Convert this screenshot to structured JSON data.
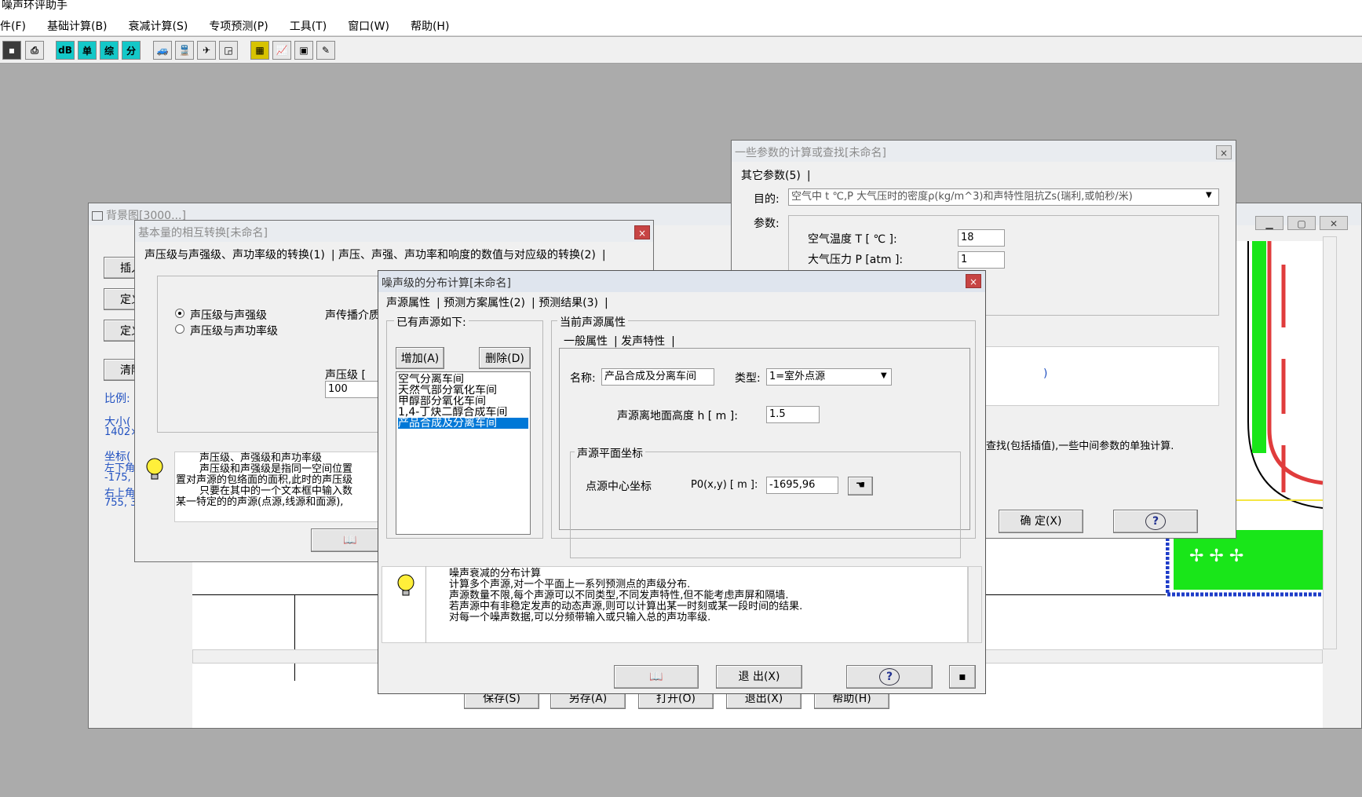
{
  "app": {
    "title": "噪声环评助手"
  },
  "menu": [
    "件(F)",
    "基础计算(B)",
    "衰减计算(S)",
    "专项预测(P)",
    "工具(T)",
    "窗口(W)",
    "帮助(H)"
  ],
  "toolbar": {
    "buttons": [
      "dB",
      "单",
      "综",
      "分"
    ]
  },
  "bg_window": {
    "title": "背景图[3000...]",
    "side_buttons": [
      "插入",
      "定义",
      "定义",
      "清除"
    ],
    "scale_label": "比例:",
    "size_label": "大小(",
    "size_value": "1402×",
    "coord_label": "坐标(",
    "lower_left": "左下角",
    "lower_left_value": "-175,",
    "upper_right": "右上角",
    "upper_right_value": "755, 3",
    "bottom_buttons": [
      "保存(S)",
      "另存(A)",
      "打开(O)",
      "退出(X)",
      "帮助(H)"
    ]
  },
  "params_window": {
    "title": "一些参数的计算或查找[未命名]",
    "tab": "其它参数(5)",
    "purpose_label": "目的:",
    "purpose_value": "空气中 t ℃,P 大气压时的密度ρ(kg/m^3)和声特性阻抗Zs(瑞利,或帕秒/米)",
    "params_label": "参数:",
    "temp_label": "空气温度 T [ ℃ ]:",
    "temp_value": "18",
    "pressure_label": "大气压力 P [atm ]:",
    "pressure_value": "1",
    "info_text": "查找(包括插值),一些中间参数的单独计算.",
    "ok_button": "确 定(X)",
    "result_fragment": ")"
  },
  "convert_window": {
    "title": "基本量的相互转换[未命名]",
    "tabs": [
      "声压级与声强级、声功率级的转换(1)",
      "声压、声强、声功率和响度的数值与对应级的转换(2)"
    ],
    "radio1": "声压级与声强级",
    "radio2": "声压级与声功率级",
    "medium_label": "声传播介质",
    "spl_label": "声压级 [",
    "spl_value": "100",
    "info_lines": [
      "声压级、声强级和声功率级",
      "声压级和声强级是指同一空间位置",
      "置对声源的包络面的面积,此时的声压级",
      "只要在其中的一个文本框中输入数",
      "某一特定的的声源(点源,线源和面源),"
    ]
  },
  "noise_window": {
    "title": "噪声级的分布计算[未命名]",
    "tabs": [
      "声源属性",
      "预测方案属性(2)",
      "预测结果(3)"
    ],
    "existing_label": "已有声源如下:",
    "add_button": "增加(A)",
    "delete_button": "删除(D)",
    "sources": [
      "空气分离车间",
      "天然气部分氧化车间",
      "甲醇部分氧化车间",
      "1,4-丁炔二醇合成车间",
      "产品合成及分离车间"
    ],
    "selected_index": 4,
    "current_label": "当前声源属性",
    "subtabs": [
      "一般属性",
      "发声特性"
    ],
    "name_label": "名称:",
    "name_value": "产品合成及分离车间",
    "type_label": "类型:",
    "type_value": "1=室外点源",
    "height_label": "声源离地面高度  h [ m ]:",
    "height_value": "1.5",
    "coord_group": "声源平面坐标",
    "point_label": "点源中心坐标",
    "p0_label": "P0(x,y) [ m ]:",
    "p0_value": "-1695,96",
    "info_lines": [
      "噪声衰减的分布计算",
      "计算多个声源,对一个平面上一系列预测点的声级分布.",
      "声源数量不限,每个声源可以不同类型,不同发声特性,但不能考虑声屏和隔墙.",
      "若声源中有非稳定发声的动态声源,则可以计算出某一时刻或某一段时间的结果.",
      "对每一个噪声数据,可以分频带输入或只输入总的声功率级."
    ],
    "exit_button": "退 出(X)"
  },
  "colors": {
    "accent": "#0078d7",
    "cyan": "#14c8c8",
    "green": "#00e000",
    "blue_line": "#1e3cc8",
    "red_line": "#e03c3c"
  }
}
